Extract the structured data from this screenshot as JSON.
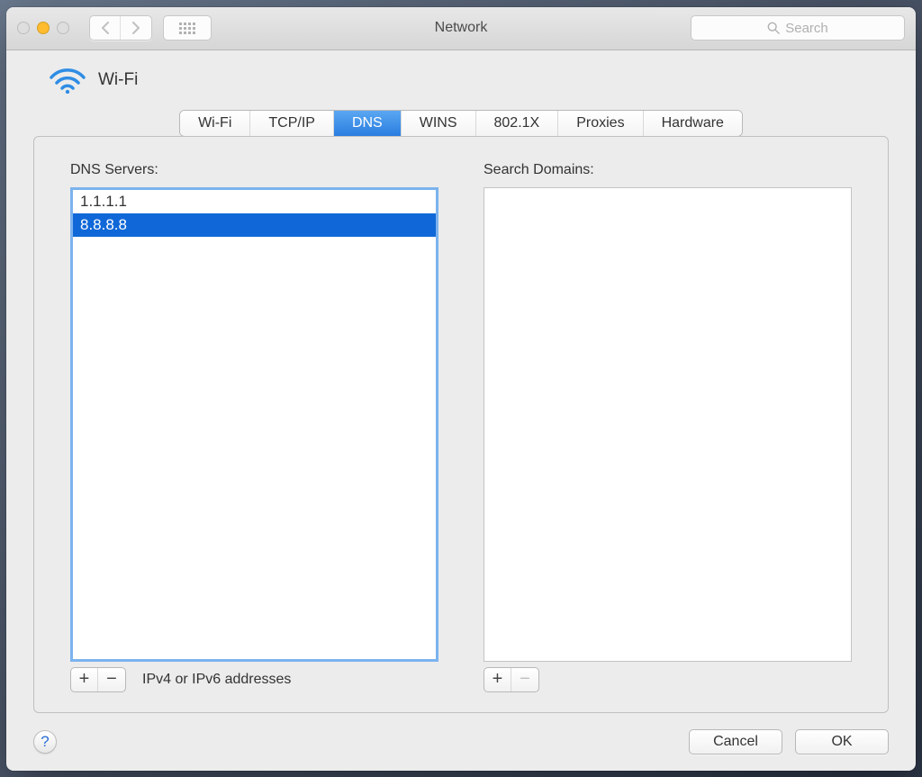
{
  "window": {
    "title": "Network",
    "search_placeholder": "Search"
  },
  "header": {
    "interface_label": "Wi-Fi"
  },
  "tabs": [
    {
      "label": "Wi-Fi",
      "active": false
    },
    {
      "label": "TCP/IP",
      "active": false
    },
    {
      "label": "DNS",
      "active": true
    },
    {
      "label": "WINS",
      "active": false
    },
    {
      "label": "802.1X",
      "active": false
    },
    {
      "label": "Proxies",
      "active": false
    },
    {
      "label": "Hardware",
      "active": false
    }
  ],
  "dns_panel": {
    "servers_label": "DNS Servers:",
    "servers": [
      {
        "value": "1.1.1.1",
        "selected": false
      },
      {
        "value": "8.8.8.8",
        "selected": true
      }
    ],
    "hint": "IPv4 or IPv6 addresses",
    "domains_label": "Search Domains:",
    "domains": []
  },
  "buttons": {
    "plus": "+",
    "minus": "−",
    "help": "?",
    "cancel": "Cancel",
    "ok": "OK"
  }
}
